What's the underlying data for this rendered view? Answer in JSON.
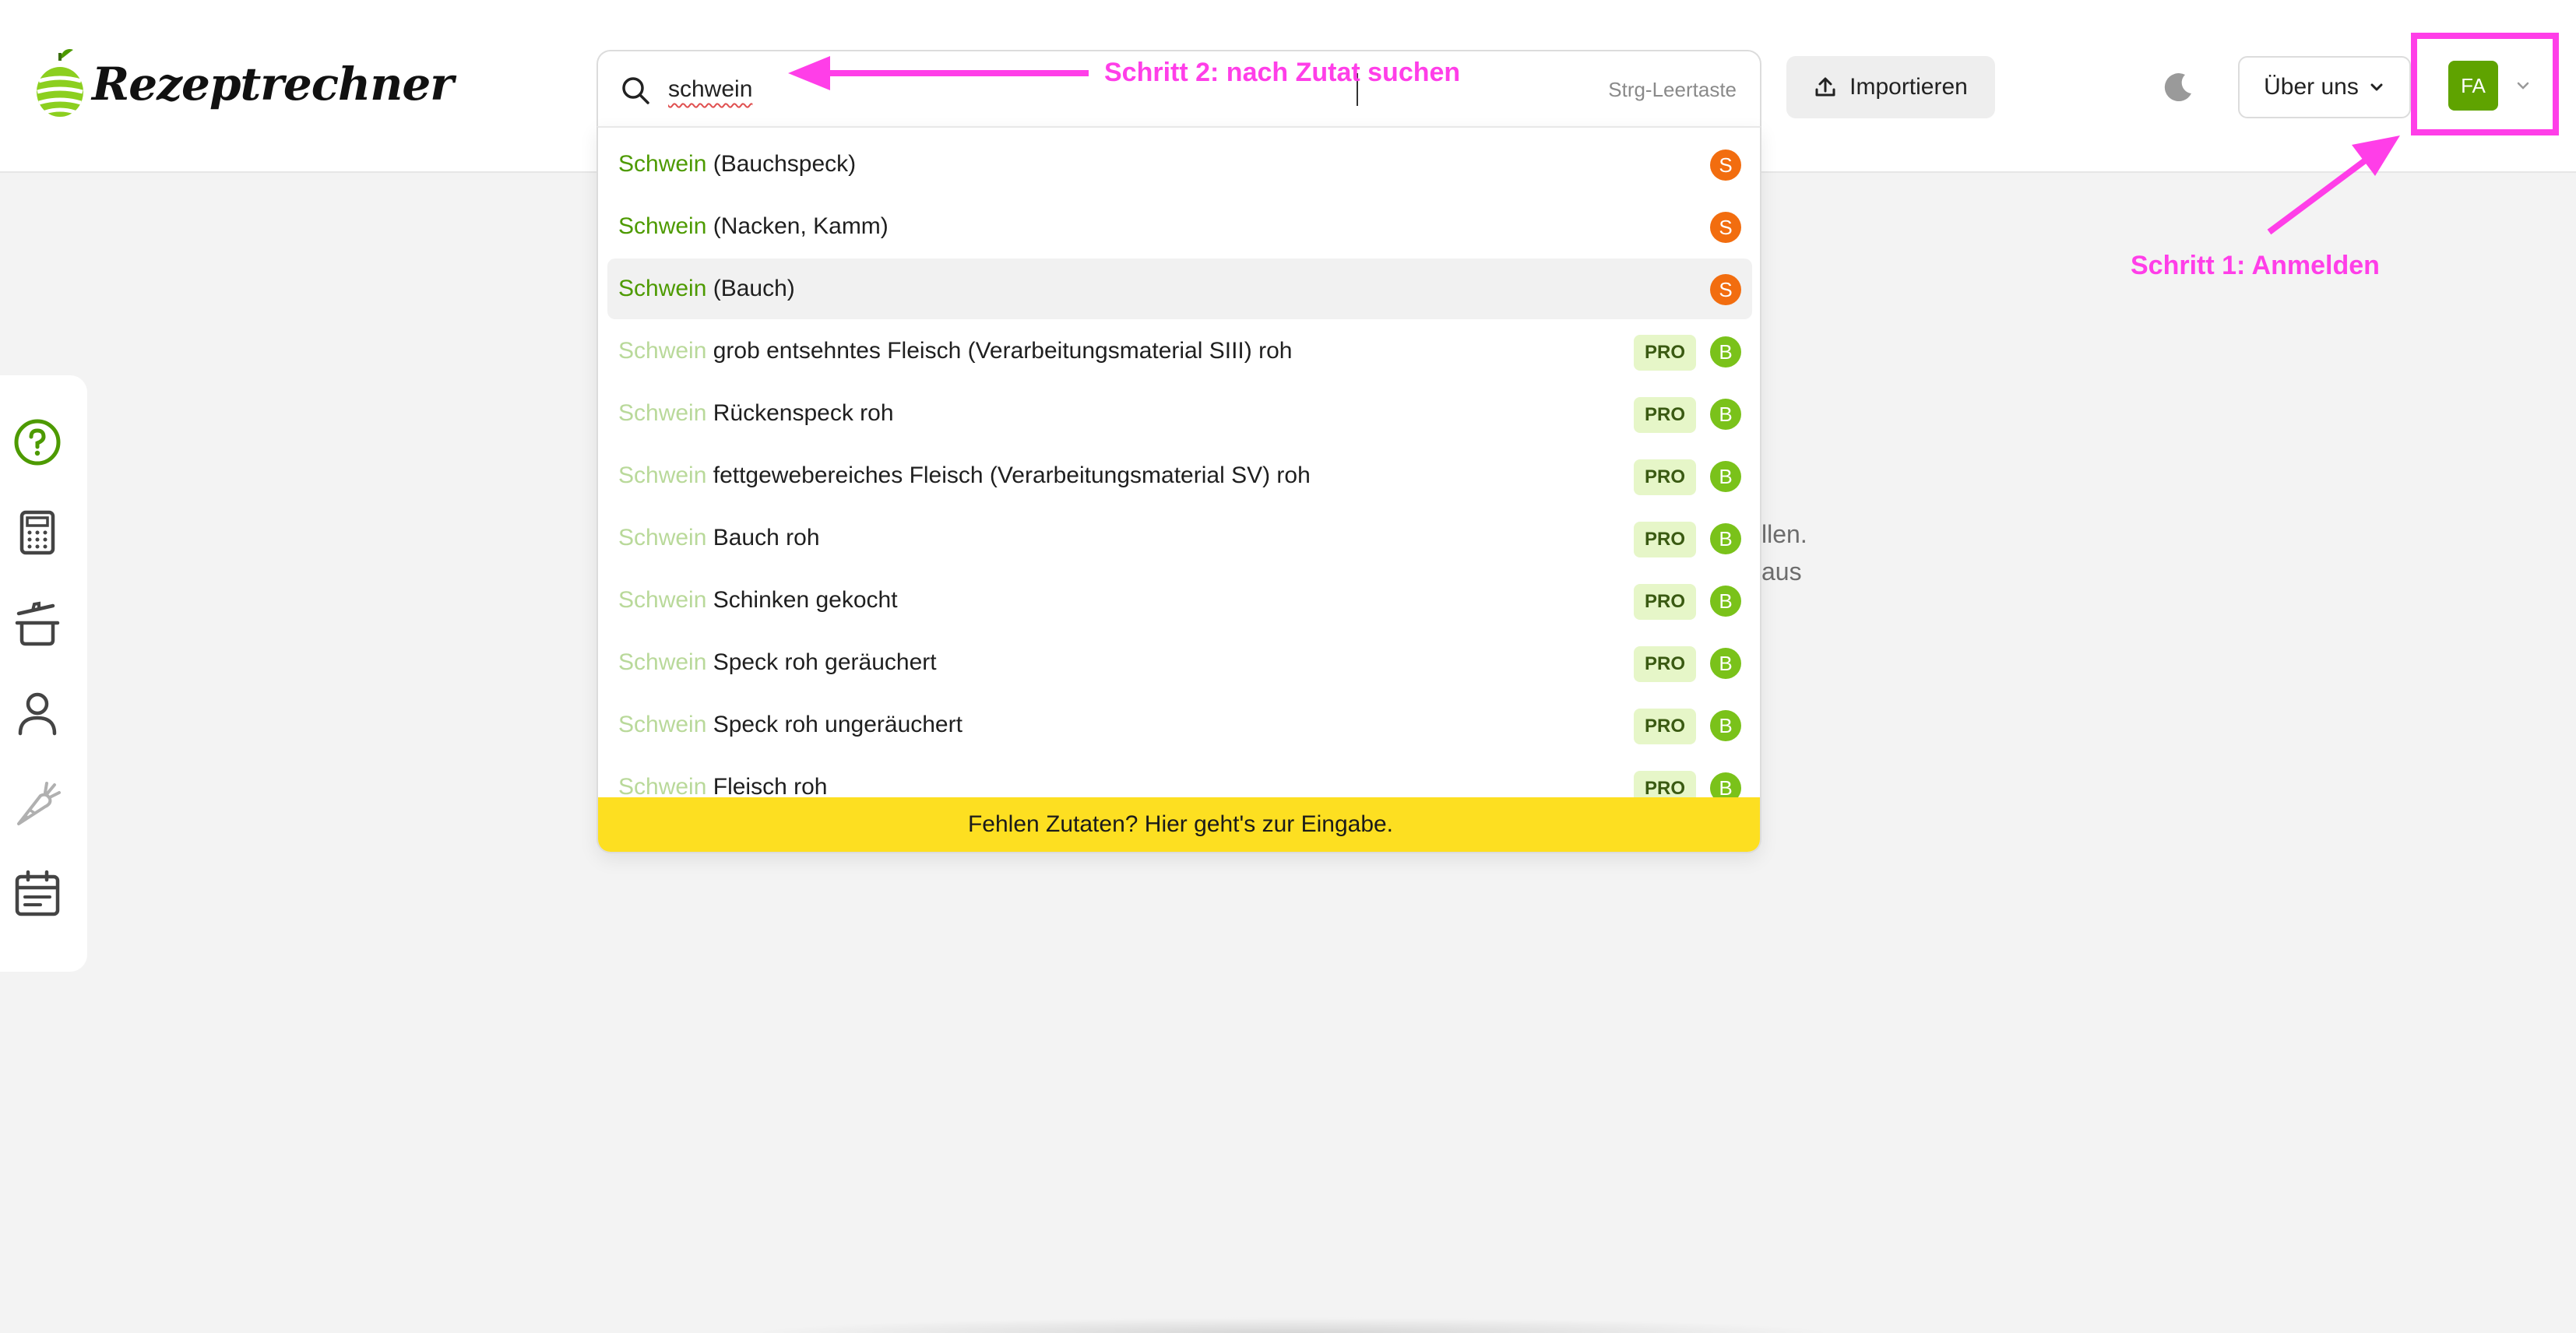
{
  "app": {
    "name": "Rezeptrechner"
  },
  "search": {
    "value": "schwein",
    "shortcut": "Strg-Leertaste"
  },
  "header": {
    "import_label": "Importieren",
    "about_label": "Über uns",
    "avatar_initials": "FA"
  },
  "annotations": {
    "step1": "Schritt 1: Anmelden",
    "step2": "Schritt 2: nach Zutat suchen",
    "color": "#ff3ee8"
  },
  "background_text": {
    "line1_fragment": "llen.",
    "line2_fragment": "aus"
  },
  "results": [
    {
      "match": "Schwein",
      "rest": " (Bauchspeck)",
      "pro": "",
      "source": "S",
      "strong": true
    },
    {
      "match": "Schwein",
      "rest": " (Nacken, Kamm)",
      "pro": "",
      "source": "S",
      "strong": true
    },
    {
      "match": "Schwein",
      "rest": " (Bauch)",
      "pro": "",
      "source": "S",
      "strong": true,
      "highlighted": true
    },
    {
      "match": "Schwein",
      "rest": " grob entsehntes Fleisch (Verarbeitungsmaterial SIII) roh",
      "pro": "PRO",
      "source": "B",
      "strong": false
    },
    {
      "match": "Schwein",
      "rest": " Rückenspeck roh",
      "pro": "PRO",
      "source": "B",
      "strong": false
    },
    {
      "match": "Schwein",
      "rest": " fettgewebereiches Fleisch (Verarbeitungsmaterial SV) roh",
      "pro": "PRO",
      "source": "B",
      "strong": false
    },
    {
      "match": "Schwein",
      "rest": " Bauch roh",
      "pro": "PRO",
      "source": "B",
      "strong": false
    },
    {
      "match": "Schwein",
      "rest": " Schinken gekocht",
      "pro": "PRO",
      "source": "B",
      "strong": false
    },
    {
      "match": "Schwein",
      "rest": " Speck roh geräuchert",
      "pro": "PRO",
      "source": "B",
      "strong": false
    },
    {
      "match": "Schwein",
      "rest": " Speck roh ungeräuchert",
      "pro": "PRO",
      "source": "B",
      "strong": false
    },
    {
      "match": "Schwein",
      "rest": " Fleisch roh",
      "pro": "PRO",
      "source": "B",
      "strong": false
    }
  ],
  "footer_cta": "Fehlen Zutaten? Hier geht's zur Eingabe.",
  "sidebar": {
    "items": [
      {
        "icon": "help-circle-icon"
      },
      {
        "icon": "calculator-icon"
      },
      {
        "icon": "cooking-pot-icon"
      },
      {
        "icon": "user-icon"
      },
      {
        "icon": "carrot-icon"
      },
      {
        "icon": "calendar-icon"
      }
    ]
  },
  "colors": {
    "brand_green": "#5fa300",
    "source_s": "#f26d0f",
    "source_b": "#7ac21a",
    "cta_yellow": "#fddf21"
  }
}
